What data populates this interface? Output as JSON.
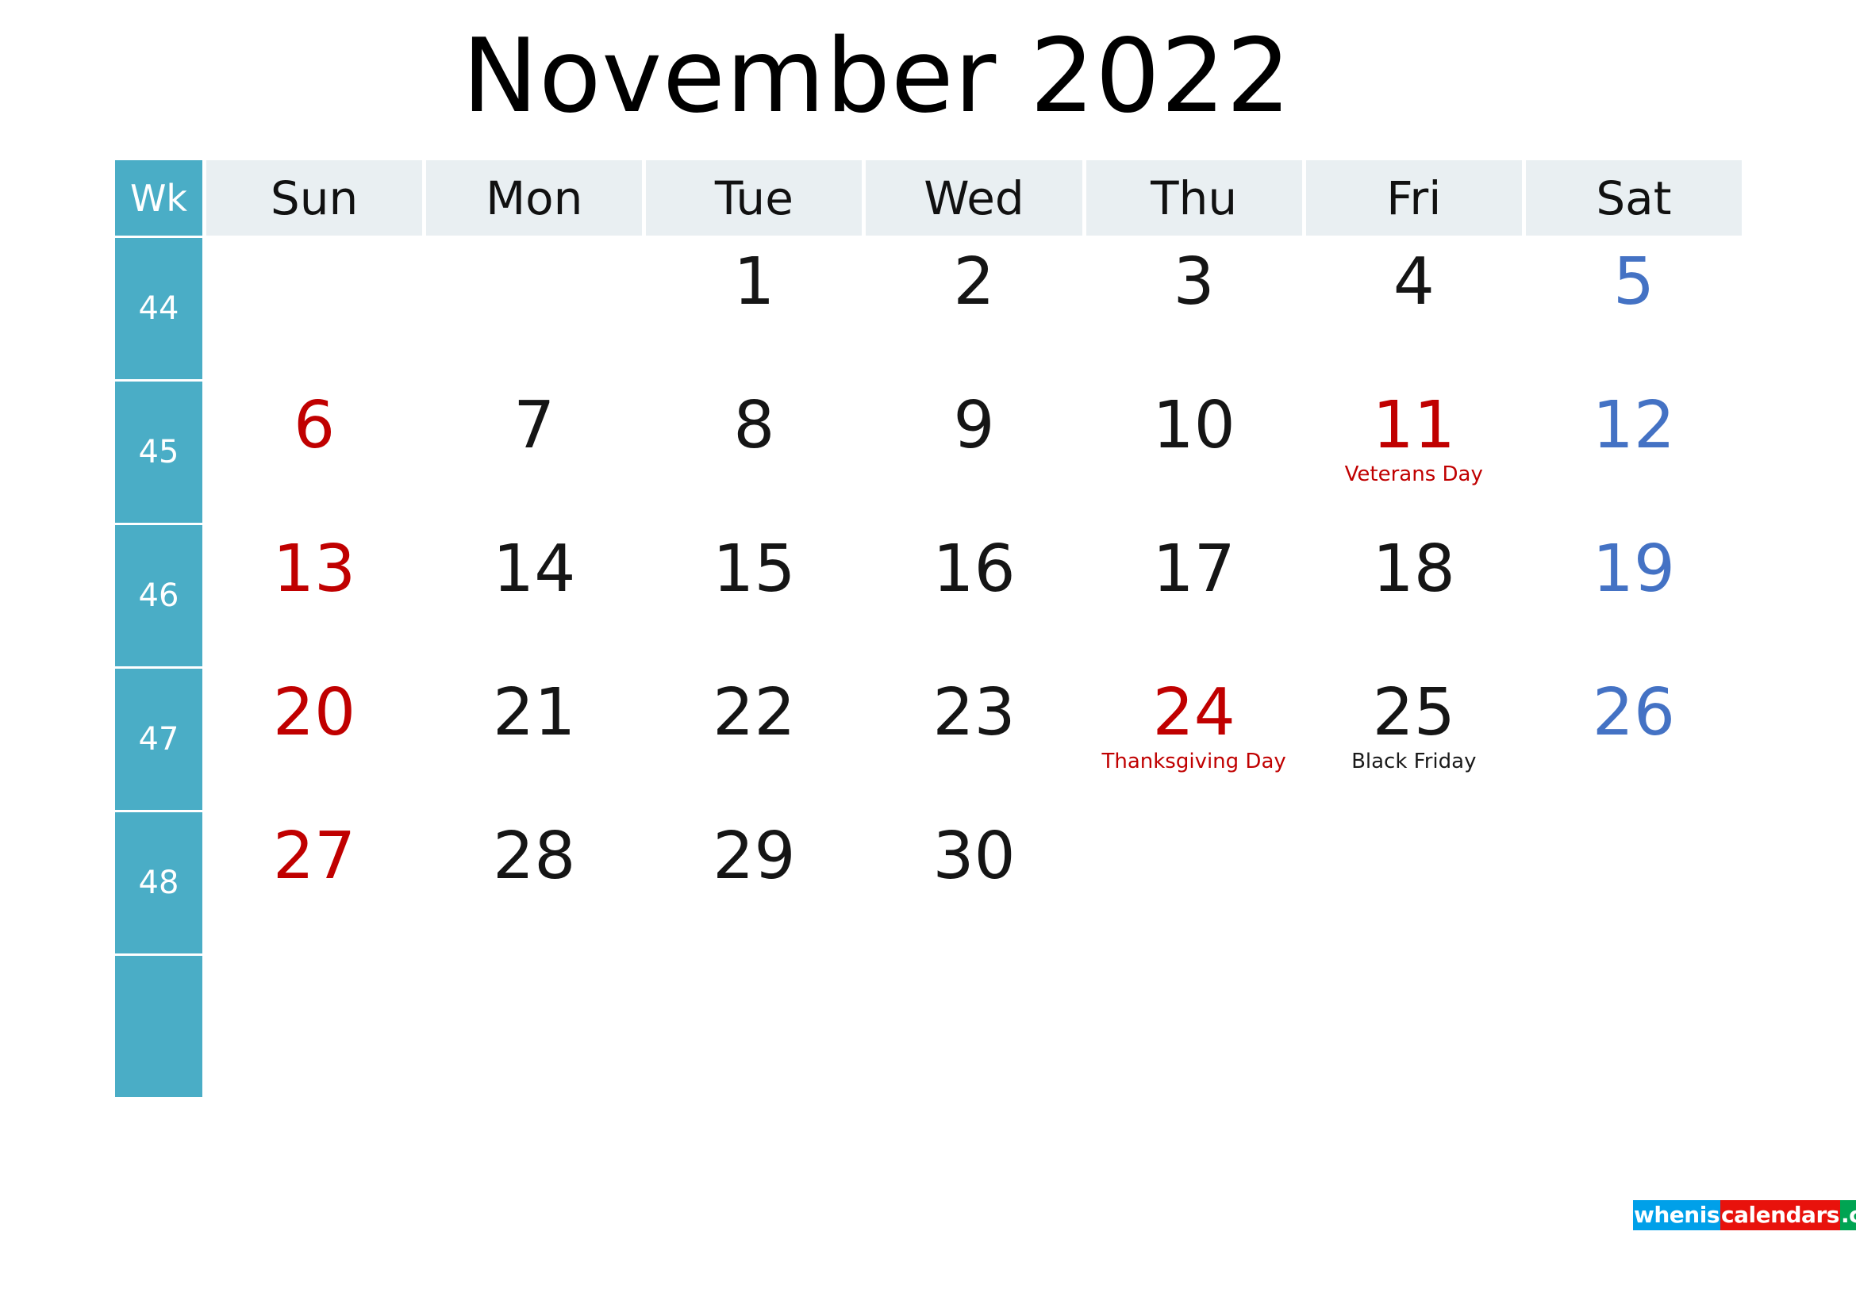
{
  "title": "November 2022",
  "header": {
    "week_label": "Wk",
    "weekdays": [
      "Sun",
      "Mon",
      "Tue",
      "Wed",
      "Thu",
      "Fri",
      "Sat"
    ]
  },
  "colors": {
    "week_column": "#4aadc6",
    "header_cell": "#e9eff2",
    "sunday": "#c00000",
    "saturday": "#4472c4",
    "weekday": "#151515",
    "holiday": "#c00000"
  },
  "weeks": [
    {
      "wk": "44",
      "days": [
        {
          "num": "",
          "kind": "empty",
          "holiday": ""
        },
        {
          "num": "",
          "kind": "empty",
          "holiday": ""
        },
        {
          "num": "1",
          "kind": "weekday",
          "holiday": ""
        },
        {
          "num": "2",
          "kind": "weekday",
          "holiday": ""
        },
        {
          "num": "3",
          "kind": "weekday",
          "holiday": ""
        },
        {
          "num": "4",
          "kind": "weekday",
          "holiday": ""
        },
        {
          "num": "5",
          "kind": "sat",
          "holiday": ""
        }
      ]
    },
    {
      "wk": "45",
      "days": [
        {
          "num": "6",
          "kind": "sun",
          "holiday": ""
        },
        {
          "num": "7",
          "kind": "weekday",
          "holiday": ""
        },
        {
          "num": "8",
          "kind": "weekday",
          "holiday": ""
        },
        {
          "num": "9",
          "kind": "weekday",
          "holiday": ""
        },
        {
          "num": "10",
          "kind": "weekday",
          "holiday": ""
        },
        {
          "num": "11",
          "kind": "holiday",
          "holiday": "Veterans Day",
          "holiday_color": "red"
        },
        {
          "num": "12",
          "kind": "sat",
          "holiday": ""
        }
      ]
    },
    {
      "wk": "46",
      "days": [
        {
          "num": "13",
          "kind": "sun",
          "holiday": ""
        },
        {
          "num": "14",
          "kind": "weekday",
          "holiday": ""
        },
        {
          "num": "15",
          "kind": "weekday",
          "holiday": ""
        },
        {
          "num": "16",
          "kind": "weekday",
          "holiday": ""
        },
        {
          "num": "17",
          "kind": "weekday",
          "holiday": ""
        },
        {
          "num": "18",
          "kind": "weekday",
          "holiday": ""
        },
        {
          "num": "19",
          "kind": "sat",
          "holiday": ""
        }
      ]
    },
    {
      "wk": "47",
      "days": [
        {
          "num": "20",
          "kind": "sun",
          "holiday": ""
        },
        {
          "num": "21",
          "kind": "weekday",
          "holiday": ""
        },
        {
          "num": "22",
          "kind": "weekday",
          "holiday": ""
        },
        {
          "num": "23",
          "kind": "weekday",
          "holiday": ""
        },
        {
          "num": "24",
          "kind": "holiday",
          "holiday": "Thanksgiving Day",
          "holiday_color": "red"
        },
        {
          "num": "25",
          "kind": "weekday",
          "holiday": "Black Friday",
          "holiday_color": "black"
        },
        {
          "num": "26",
          "kind": "sat",
          "holiday": ""
        }
      ]
    },
    {
      "wk": "48",
      "days": [
        {
          "num": "27",
          "kind": "sun",
          "holiday": ""
        },
        {
          "num": "28",
          "kind": "weekday",
          "holiday": ""
        },
        {
          "num": "29",
          "kind": "weekday",
          "holiday": ""
        },
        {
          "num": "30",
          "kind": "weekday",
          "holiday": ""
        },
        {
          "num": "",
          "kind": "empty",
          "holiday": ""
        },
        {
          "num": "",
          "kind": "empty",
          "holiday": ""
        },
        {
          "num": "",
          "kind": "empty",
          "holiday": ""
        }
      ]
    },
    {
      "wk": "",
      "days": [
        {
          "num": "",
          "kind": "empty",
          "holiday": ""
        },
        {
          "num": "",
          "kind": "empty",
          "holiday": ""
        },
        {
          "num": "",
          "kind": "empty",
          "holiday": ""
        },
        {
          "num": "",
          "kind": "empty",
          "holiday": ""
        },
        {
          "num": "",
          "kind": "empty",
          "holiday": ""
        },
        {
          "num": "",
          "kind": "empty",
          "holiday": ""
        },
        {
          "num": "",
          "kind": "empty",
          "holiday": ""
        }
      ]
    }
  ],
  "watermark": {
    "part1": "whenis",
    "part2": "calendars",
    "part3": ".com"
  }
}
